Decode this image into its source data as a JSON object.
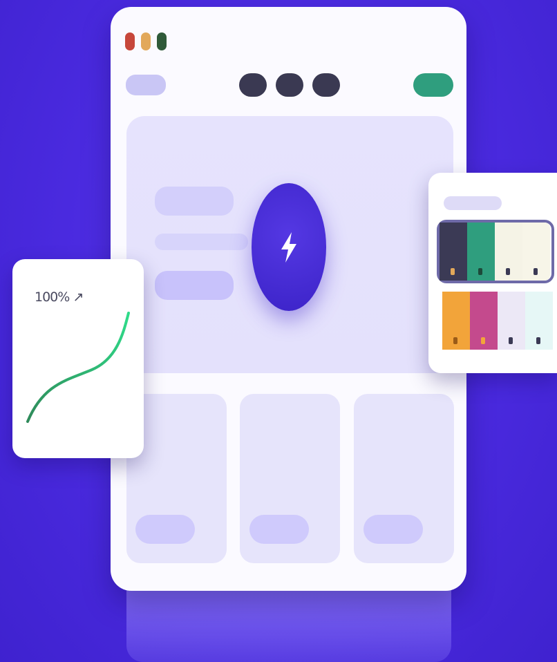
{
  "colors": {
    "background": "#4a2adf",
    "window": "#fbfaff",
    "accent": "#3c23c8",
    "nav_dark": "#3a3952",
    "cta_green": "#2f9e7e",
    "hero_panel": "#e5e2fc",
    "placeholder_lavender": "#cfcafc"
  },
  "window_controls": [
    {
      "name": "close",
      "color": "#c7473b"
    },
    {
      "name": "minimize",
      "color": "#e2a85a"
    },
    {
      "name": "maximize",
      "color": "#2f5a39"
    }
  ],
  "hero": {
    "action_icon": "lightning-bolt-icon"
  },
  "stat_card": {
    "value_label": "100% ↗",
    "curve_color": "#2fbf7f"
  },
  "palette_card": {
    "rows": [
      {
        "selected": true,
        "swatches": [
          "#3b3a55",
          "#2f9e7e",
          "#f5f3e6",
          "#f7f5e8"
        ]
      },
      {
        "selected": false,
        "swatches": [
          "#f2a43a",
          "#c44a8d",
          "#ece8f6",
          "#e6f7f6"
        ]
      }
    ]
  }
}
